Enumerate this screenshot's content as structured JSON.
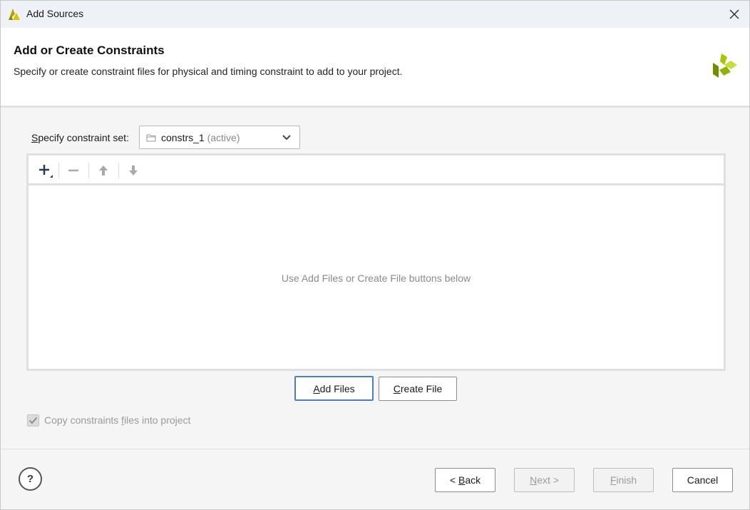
{
  "window": {
    "title": "Add Sources",
    "close_glyph": "✕",
    "app_icon": "vivado-logo-icon"
  },
  "header": {
    "title": "Add or Create Constraints",
    "subtitle": "Specify or create constraint files for physical and timing constraint to add to your project.",
    "logo": "xilinx-logo-icon",
    "accent_color": "#8cb400"
  },
  "constraint_set": {
    "label_mnemonic": "S",
    "label_rest": "pecify constraint set:",
    "value": "constrs_1",
    "status": "(active)",
    "icon": "folder-icon"
  },
  "toolbar": {
    "add": "plus-icon",
    "remove": "minus-icon",
    "move_up": "arrow-up-icon",
    "move_down": "arrow-down-icon"
  },
  "file_list": {
    "empty_message": "Use Add Files or Create File buttons below"
  },
  "actions": {
    "add_files": {
      "mnemonic": "A",
      "rest": "dd Files"
    },
    "create_file": {
      "mnemonic": "C",
      "rest": "reate File"
    }
  },
  "copy_option": {
    "label_prefix": "Copy constraints ",
    "label_mnemonic": "f",
    "label_suffix": "iles into project",
    "checked": true,
    "enabled": false
  },
  "footer": {
    "help": "?",
    "back": {
      "prefix": "< ",
      "mnemonic": "B",
      "rest": "ack"
    },
    "next": {
      "mnemonic": "N",
      "rest": "ext >"
    },
    "finish": {
      "mnemonic": "F",
      "rest": "inish"
    },
    "cancel": "Cancel"
  }
}
